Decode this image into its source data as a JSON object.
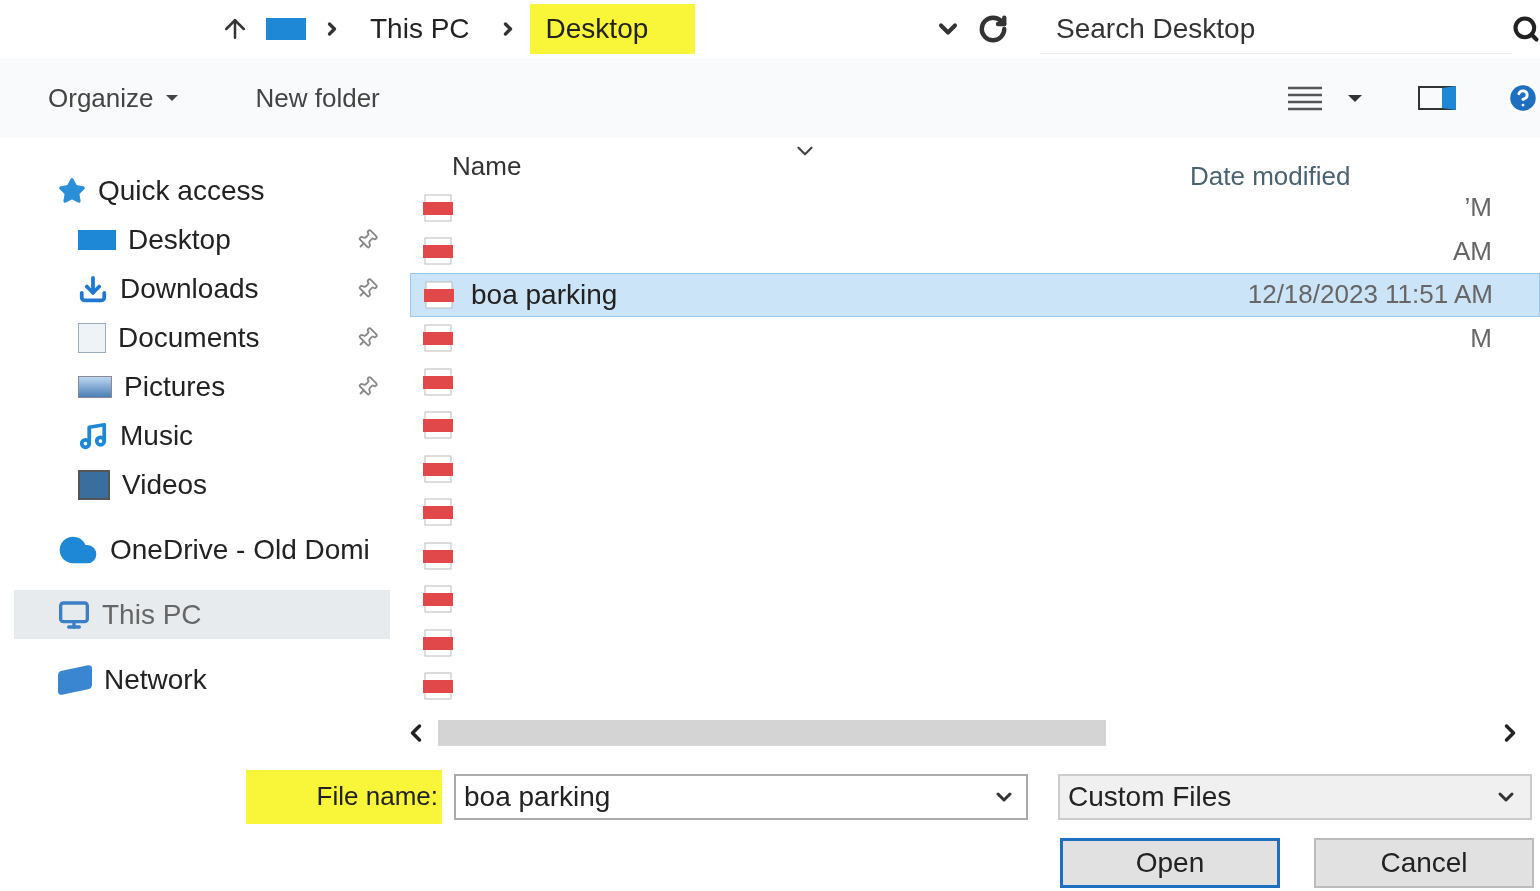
{
  "address_bar": {
    "crumbs": [
      {
        "label": "This PC",
        "highlighted": false
      },
      {
        "label": "Desktop",
        "highlighted": true
      }
    ]
  },
  "search": {
    "placeholder": "Search Desktop"
  },
  "toolbar": {
    "organize": "Organize",
    "new_folder": "New folder"
  },
  "sidebar": {
    "items": [
      {
        "label": "Quick access",
        "pinned": false,
        "selected": false,
        "group": true
      },
      {
        "label": "Desktop",
        "pinned": true,
        "selected": false,
        "group": false
      },
      {
        "label": "Downloads",
        "pinned": true,
        "selected": false,
        "group": false
      },
      {
        "label": "Documents",
        "pinned": true,
        "selected": false,
        "group": false
      },
      {
        "label": "Pictures",
        "pinned": true,
        "selected": false,
        "group": false
      },
      {
        "label": "Music",
        "pinned": false,
        "selected": false,
        "group": false
      },
      {
        "label": "Videos",
        "pinned": false,
        "selected": false,
        "group": false
      },
      {
        "label": "OneDrive - Old Domi",
        "pinned": false,
        "selected": false,
        "group": true
      },
      {
        "label": "This PC",
        "pinned": false,
        "selected": true,
        "group": true
      },
      {
        "label": "Network",
        "pinned": false,
        "selected": false,
        "group": true
      }
    ]
  },
  "table": {
    "columns": [
      "Name",
      "Date modified"
    ],
    "rows": [
      {
        "name": "",
        "date": "’M",
        "selected": false
      },
      {
        "name": "",
        "date": "AM",
        "selected": false
      },
      {
        "name": "boa parking",
        "date": "12/18/2023 11:51 AM",
        "selected": true
      },
      {
        "name": "",
        "date": "M",
        "selected": false
      },
      {
        "name": "",
        "date": "",
        "selected": false
      },
      {
        "name": "",
        "date": "",
        "selected": false
      },
      {
        "name": "",
        "date": "",
        "selected": false
      },
      {
        "name": "",
        "date": "",
        "selected": false
      },
      {
        "name": "",
        "date": "",
        "selected": false
      },
      {
        "name": "",
        "date": "",
        "selected": false
      },
      {
        "name": "",
        "date": "",
        "selected": false
      },
      {
        "name": "",
        "date": "",
        "selected": false
      }
    ]
  },
  "file_name": {
    "label": "File name:",
    "highlighted": true,
    "value": "boa parking"
  },
  "file_type": {
    "value": "Custom Files"
  },
  "buttons": [
    {
      "label": "Open",
      "kind": "primary"
    },
    {
      "label": "Cancel",
      "kind": "secondary"
    }
  ]
}
